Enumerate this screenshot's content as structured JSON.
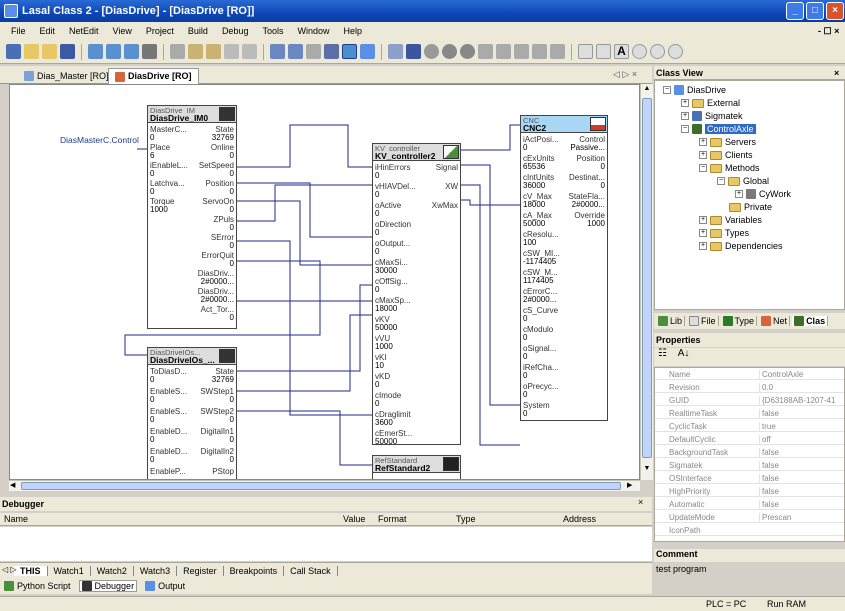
{
  "window": {
    "title": "Lasal Class 2 - [DiasDrive] - [DiasDrive [RO]]",
    "mdi_controls": "- ☐ ×"
  },
  "menu": [
    "File",
    "Edit",
    "NetEdit",
    "View",
    "Project",
    "Build",
    "Debug",
    "Tools",
    "Window",
    "Help"
  ],
  "editor_tabs": [
    {
      "label": "Dias_Master [RO]"
    },
    {
      "label": "DiasDrive [RO]",
      "active": true
    }
  ],
  "tab_nav": "◁ ▷ ×",
  "canvas": {
    "master_label": "DiasMasterC.Control",
    "blocks": {
      "dias_im": {
        "type": "DiasDrive_IM",
        "name": "DiasDrive_IM0",
        "pins": [
          {
            "l": "MasterC...",
            "lv": "0",
            "r": "State",
            "rv": "32769"
          },
          {
            "l": "Place",
            "lv": "6",
            "r": "Online",
            "rv": "0"
          },
          {
            "l": "iEnableL...",
            "lv": "0",
            "r": "SetSpeed",
            "rv": "0"
          },
          {
            "l": "Latchva...",
            "lv": "0",
            "r": "Position",
            "rv": "0"
          },
          {
            "l": "Torque",
            "lv": "1000",
            "r": "ServoOn",
            "rv": "0"
          },
          {
            "l": "",
            "lv": "",
            "r": "ZPuls",
            "rv": "0"
          },
          {
            "l": "",
            "lv": "",
            "r": "SError",
            "rv": "0"
          },
          {
            "l": "",
            "lv": "",
            "r": "ErrorQuit",
            "rv": "0"
          },
          {
            "l": "",
            "lv": "",
            "r": "DiasDriv...",
            "rv": "2#0000..."
          },
          {
            "l": "",
            "lv": "",
            "r": "DiasDriv...",
            "rv": "2#0000..."
          },
          {
            "l": "",
            "lv": "",
            "r": "Act_Tor...",
            "rv": "0"
          }
        ]
      },
      "dias_os": {
        "type": "DiasDriveIOs...",
        "name": "DiasDriveIOs_...",
        "pins": [
          {
            "l": "ToDiasD...",
            "lv": "0",
            "r": "State",
            "rv": "32769"
          },
          {
            "l": "EnableS...",
            "lv": "0",
            "r": "SWStep1",
            "rv": "0"
          },
          {
            "l": "EnableS...",
            "lv": "0",
            "r": "SWStep2",
            "rv": "0"
          },
          {
            "l": "EnableD...",
            "lv": "0",
            "r": "DigitalIn1",
            "rv": "0"
          },
          {
            "l": "EnableD...",
            "lv": "0",
            "r": "DigitalIn2",
            "rv": "0"
          },
          {
            "l": "EnableP...",
            "lv": "",
            "r": "PStop",
            "rv": ""
          }
        ]
      },
      "kv": {
        "type": "KV_controller",
        "name": "KV_controller2",
        "pins": [
          {
            "l": "iHinErrors",
            "lv": "0",
            "r": "Signal",
            "rv": ""
          },
          {
            "l": "vHIAVDel...",
            "lv": "0",
            "r": "XW",
            "rv": ""
          },
          {
            "l": "oActive",
            "lv": "0",
            "r": "XwMax",
            "rv": ""
          },
          {
            "l": "oDirection",
            "lv": "0",
            "r": "",
            "rv": ""
          },
          {
            "l": "oOutput...",
            "lv": "0",
            "r": "",
            "rv": ""
          },
          {
            "l": "cMaxSi...",
            "lv": "30000",
            "r": "",
            "rv": ""
          },
          {
            "l": "cOffSig...",
            "lv": "0",
            "r": "",
            "rv": ""
          },
          {
            "l": "cMaxSp...",
            "lv": "18000",
            "r": "",
            "rv": ""
          },
          {
            "l": "vKV",
            "lv": "50000",
            "r": "",
            "rv": ""
          },
          {
            "l": "vVU",
            "lv": "1000",
            "r": "",
            "rv": ""
          },
          {
            "l": "vKI",
            "lv": "10",
            "r": "",
            "rv": ""
          },
          {
            "l": "vKD",
            "lv": "0",
            "r": "",
            "rv": ""
          },
          {
            "l": "cImode",
            "lv": "0",
            "r": "",
            "rv": ""
          },
          {
            "l": "cDraglimit",
            "lv": "3600",
            "r": "",
            "rv": ""
          },
          {
            "l": "cEmerSt...",
            "lv": "50000",
            "r": "",
            "rv": ""
          }
        ]
      },
      "cnc": {
        "type": "CNC",
        "name": "CNC2",
        "pins": [
          {
            "l": "iActPosi...",
            "lv": "0",
            "r": "Control",
            "rv": "Passive..."
          },
          {
            "l": "cExUnits",
            "lv": "65536",
            "r": "Position",
            "rv": "0"
          },
          {
            "l": "cIntUnits",
            "lv": "36000",
            "r": "Destinat...",
            "rv": "0"
          },
          {
            "l": "cV_Max",
            "lv": "18000",
            "r": "StateFla...",
            "rv": "2#0000..."
          },
          {
            "l": "cA_Max",
            "lv": "50000",
            "r": "Override",
            "rv": "1000"
          },
          {
            "l": "cResolu...",
            "lv": "100",
            "r": "",
            "rv": ""
          },
          {
            "l": "cSW_MI...",
            "lv": "-1174405",
            "r": "",
            "rv": ""
          },
          {
            "l": "cSW_M...",
            "lv": "1174405",
            "r": "",
            "rv": ""
          },
          {
            "l": "cErrorC...",
            "lv": "2#0000...",
            "r": "",
            "rv": ""
          },
          {
            "l": "cS_Curve",
            "lv": "0",
            "r": "",
            "rv": ""
          },
          {
            "l": "cModulo",
            "lv": "0",
            "r": "",
            "rv": ""
          },
          {
            "l": "oSignal...",
            "lv": "0",
            "r": "",
            "rv": ""
          },
          {
            "l": "iRefCha...",
            "lv": "0",
            "r": "",
            "rv": ""
          },
          {
            "l": "oPrecyc...",
            "lv": "0",
            "r": "",
            "rv": ""
          },
          {
            "l": "System",
            "lv": "0",
            "r": "",
            "rv": ""
          }
        ]
      },
      "ref": {
        "type": "RefStandard",
        "name": "RefStandard2"
      }
    }
  },
  "debugger": {
    "title": "Debugger",
    "close": "×",
    "columns": {
      "name": "Name",
      "value": "Value",
      "format": "Format",
      "type": "Type",
      "address": "Address"
    },
    "tabs": [
      "THIS",
      "Watch1",
      "Watch2",
      "Watch3",
      "Register",
      "Breakpoints",
      "Call Stack"
    ],
    "tab_nav": "◁ ▷"
  },
  "output_tabs": [
    "Python Script",
    "Debugger",
    "Output"
  ],
  "status": {
    "plc": "PLC = PC",
    "run": "Run RAM"
  },
  "class_view": {
    "title": "Class View",
    "close": "×",
    "tree": {
      "root": "DiasDrive",
      "external": "External",
      "sigmatek": "Sigmatek",
      "control_axle": "ControlAxle",
      "servers": "Servers",
      "clients": "Clients",
      "methods": "Methods",
      "global": "Global",
      "cywork": "CyWork",
      "private": "Private",
      "variables": "Variables",
      "types": "Types",
      "dependencies": "Dependencies"
    },
    "tabs": [
      "Lib",
      "File",
      "Type",
      "Net",
      "Clas"
    ]
  },
  "properties": {
    "title": "Properties",
    "tool_a": "☷",
    "tool_b": "A↓",
    "rows": [
      {
        "name": "Name",
        "value": "ControlAxle"
      },
      {
        "name": "Revision",
        "value": "0.0"
      },
      {
        "name": "GUID",
        "value": "{D63188AB-1207-41"
      },
      {
        "name": "RealtimeTask",
        "value": "false"
      },
      {
        "name": "CyclicTask",
        "value": "true"
      },
      {
        "name": "DefaultCyclic",
        "value": "off"
      },
      {
        "name": "BackgroundTask",
        "value": "false"
      },
      {
        "name": "Sigmatek",
        "value": "false"
      },
      {
        "name": "OSInterface",
        "value": "false"
      },
      {
        "name": "HighPriority",
        "value": "false"
      },
      {
        "name": "Automatic",
        "value": "false"
      },
      {
        "name": "UpdateMode",
        "value": "Prescan"
      },
      {
        "name": "IconPath",
        "value": ""
      }
    ]
  },
  "comment": {
    "title": "Comment",
    "text": "test program"
  },
  "colors": {
    "title_bar": "#0d46b8",
    "selection": "#316ac5",
    "wire": "#1f2a8c",
    "cnc_header": "#a9d6f5"
  }
}
